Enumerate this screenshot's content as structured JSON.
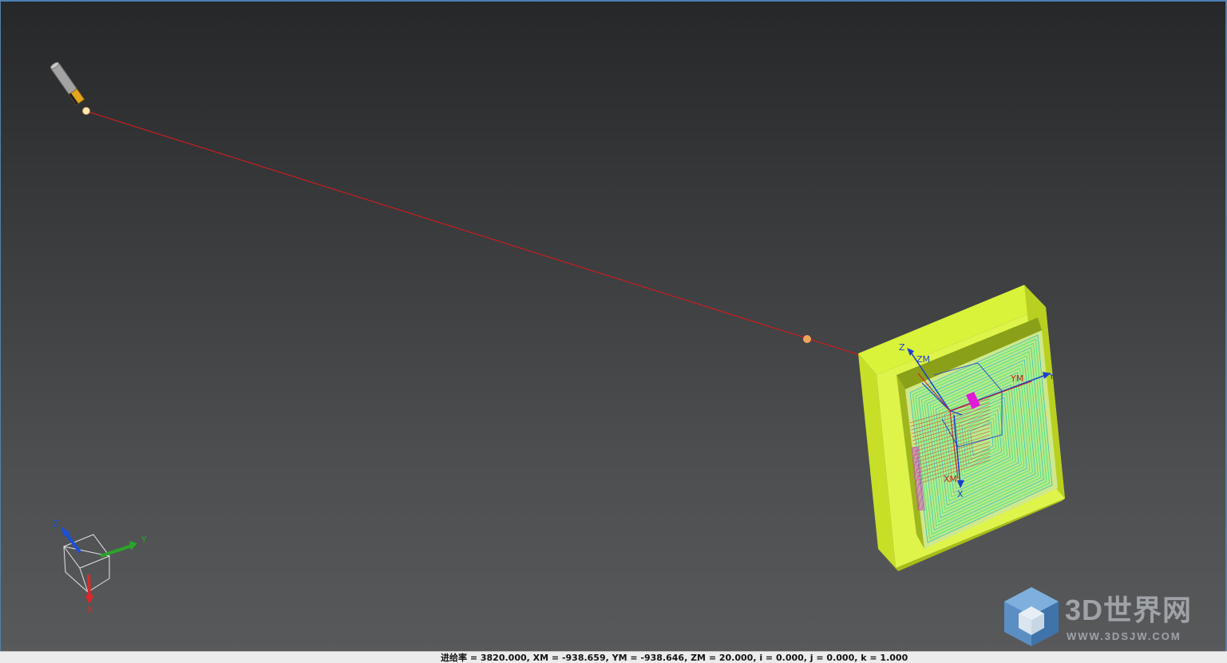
{
  "viewport": {
    "background_top": "#262729",
    "background_bottom": "#58595b",
    "toolpath_color": "#c81e1e",
    "part_color": "#d9f23a",
    "toolpath_pattern_color": "#33e07a"
  },
  "tool": {
    "icon": "end-mill-tool-icon",
    "holder_color": "#9a9a9a",
    "flute_color": "#e3a61c"
  },
  "part_csys": {
    "z_label": "Z",
    "zm_label": "ZM",
    "y_label": "Y",
    "ym_label": "YM",
    "x_label": "X",
    "xm_label": "XM"
  },
  "triad": {
    "z_label": "Z",
    "y_label": "Y",
    "x_label": "X",
    "z_color": "#1a4fd6",
    "y_color": "#2aa52a",
    "x_color": "#d62a2a"
  },
  "status": {
    "text": "进给率 = 3820.000, XM = -938.659, YM = -938.646, ZM = 20.000, i = 0.000, j = 0.000, k = 1.000"
  },
  "watermark": {
    "logo_icon": "3d-cube-logo-icon",
    "brand": "3D世界网",
    "url": "WWW.3DSJW.COM"
  }
}
